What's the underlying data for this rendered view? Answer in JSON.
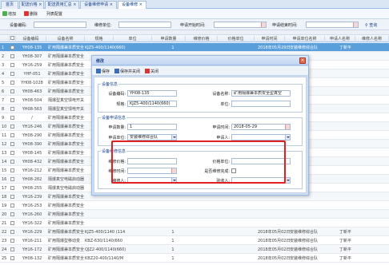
{
  "tabs": [
    "首页",
    "配送价格",
    "配送费用汇总",
    "设备维修申请",
    "设备维修"
  ],
  "toolbar": {
    "add": "增加",
    "delete": "删除",
    "column_config": "列表配置"
  },
  "search": {
    "device_no": "设备编码:",
    "repair_unit": "维修单位:",
    "apply_start": "申请开始时间:",
    "apply_end": "申请结束时间:",
    "query": "查询"
  },
  "grid": {
    "headers": [
      "设备编码",
      "设备名称",
      "规格",
      "单位",
      "申请数量",
      "维修价格",
      "价格单位",
      "申请时间",
      "申请单位名称",
      "申请人名称",
      "维修人名称"
    ],
    "rows": [
      {
        "code": "YH08-135",
        "name": "矿用隔爆兼本质安全",
        "spec": "KJZ5-400/1140(660)",
        "qty": "1",
        "date": "2018年05月29日",
        "unit": "安装维修综合队",
        "person": "丁新平"
      },
      {
        "code": "YH08-307",
        "name": "矿用隔爆兼本质安全",
        "spec": "",
        "qty": "",
        "date": "",
        "unit": "",
        "person": ""
      },
      {
        "code": "YH16-259",
        "name": "矿用隔爆兼本质安全",
        "spec": "",
        "qty": "",
        "date": "",
        "unit": "",
        "person": ""
      },
      {
        "code": "YHF-051",
        "name": "矿用隔爆兼本质安全",
        "spec": "",
        "qty": "",
        "date": "",
        "unit": "",
        "person": ""
      },
      {
        "code": "YH08-1028",
        "name": "矿用隔爆兼本质安全",
        "spec": "",
        "qty": "",
        "date": "",
        "unit": "",
        "person": ""
      },
      {
        "code": "YH08-463",
        "name": "矿用隔爆兼本质安全",
        "spec": "",
        "qty": "",
        "date": "",
        "unit": "",
        "person": ""
      },
      {
        "code": "YH08-504",
        "name": "隔爆型真空馈电开关",
        "spec": "",
        "qty": "",
        "date": "",
        "unit": "",
        "person": ""
      },
      {
        "code": "YH08-563",
        "name": "隔爆型真空馈电开关",
        "spec": "",
        "qty": "",
        "date": "",
        "unit": "",
        "person": ""
      },
      {
        "code": "/",
        "name": "矿用隔爆兼本质安全",
        "spec": "",
        "qty": "",
        "date": "",
        "unit": "",
        "person": ""
      },
      {
        "code": "YH16-246",
        "name": "矿用隔爆兼本质安全",
        "spec": "",
        "qty": "",
        "date": "",
        "unit": "",
        "person": ""
      },
      {
        "code": "YH08-290",
        "name": "矿用隔爆兼本质安全",
        "spec": "",
        "qty": "",
        "date": "",
        "unit": "",
        "person": ""
      },
      {
        "code": "YH08-390",
        "name": "矿用隔爆兼本质安全",
        "spec": "",
        "qty": "",
        "date": "",
        "unit": "",
        "person": ""
      },
      {
        "code": "YH08-145",
        "name": "矿用隔爆兼本质安全",
        "spec": "",
        "qty": "",
        "date": "",
        "unit": "",
        "person": ""
      },
      {
        "code": "YH08-432",
        "name": "矿用隔爆兼本质安全",
        "spec": "",
        "qty": "",
        "date": "",
        "unit": "",
        "person": ""
      },
      {
        "code": "YH16-212",
        "name": "矿用隔爆兼本质安全",
        "spec": "",
        "qty": "",
        "date": "",
        "unit": "",
        "person": ""
      },
      {
        "code": "YH08-282",
        "name": "隔爆真空电磁启动器",
        "spec": "",
        "qty": "",
        "date": "",
        "unit": "",
        "person": ""
      },
      {
        "code": "YH08-255",
        "name": "隔爆真空电磁启动器",
        "spec": "",
        "qty": "",
        "date": "",
        "unit": "",
        "person": ""
      },
      {
        "code": "YH16-239",
        "name": "矿用隔爆兼本质安全",
        "spec": "",
        "qty": "",
        "date": "",
        "unit": "",
        "person": ""
      },
      {
        "code": "YH16-253",
        "name": "矿用隔爆兼本质安全",
        "spec": "",
        "qty": "",
        "date": "",
        "unit": "",
        "person": ""
      },
      {
        "code": "YH16-260",
        "name": "矿用隔爆兼本质安全",
        "spec": "",
        "qty": "",
        "date": "",
        "unit": "",
        "person": ""
      },
      {
        "code": "YH16-322",
        "name": "矿用隔爆兼本质安全",
        "spec": "",
        "qty": "",
        "date": "",
        "unit": "",
        "person": ""
      },
      {
        "code": "YH16-229",
        "name": "矿用隔爆兼本质安全",
        "spec": "KJZ5-400/1140 (114",
        "qty": "1",
        "date": "2018年05月02日",
        "unit": "安装维修综合队",
        "person": "丁新平"
      },
      {
        "code": "YH16-211",
        "name": "矿用隔爆型移动变",
        "spec": "KBZ-630/1140/660",
        "qty": "1",
        "date": "2018年05月02日",
        "unit": "安装维修综合队",
        "person": "丁新平"
      },
      {
        "code": "YH16-172",
        "name": "矿用隔爆兼本质安全",
        "spec": "QJZ2-400/1140(660)",
        "qty": "1",
        "date": "2018年05月02日",
        "unit": "安装维修综合队",
        "person": "丁新平"
      },
      {
        "code": "YH08-132",
        "name": "矿用隔爆兼本质安全",
        "spec": "KBZ20-400/1140/M",
        "qty": "1",
        "date": "2018年05月02日",
        "unit": "安装维修综合队",
        "person": "丁新平"
      }
    ]
  },
  "dialog": {
    "title": "修改",
    "toolbar": {
      "save": "保存",
      "save_close": "保存并关闭",
      "close": "关闭"
    },
    "device_info": {
      "legend": "设备信息",
      "code_label": "设备编码:",
      "code_value": "YH08-135",
      "name_label": "设备名称:",
      "name_value": "矿用隔爆兼本质安全型真空",
      "spec_label": "规格:",
      "spec_value": "KJZ5-400/1140(660)",
      "unit_label": "单位:",
      "unit_value": ""
    },
    "apply_info": {
      "legend": "设备申请信息",
      "qty_label": "申请数量:",
      "qty_value": "1",
      "time_label": "申请时间:",
      "time_value": "2018-05-29",
      "unit_label": "申请单位:",
      "unit_value": "安装维修综合队",
      "person_label": "申请人:",
      "person_value": ""
    },
    "repair_info": {
      "legend": "设备维修信息",
      "price_label": "维修价格:",
      "price_value": "",
      "price_unit_label": "价格单位:",
      "price_unit_value": "",
      "repair_time_label": "维修时间:",
      "repair_time_value": "",
      "done_label": "是否维修完成:",
      "repairer_label": "维修人:",
      "repairer_value": "",
      "acceptor_label": "验收人:",
      "acceptor_value": ""
    }
  }
}
